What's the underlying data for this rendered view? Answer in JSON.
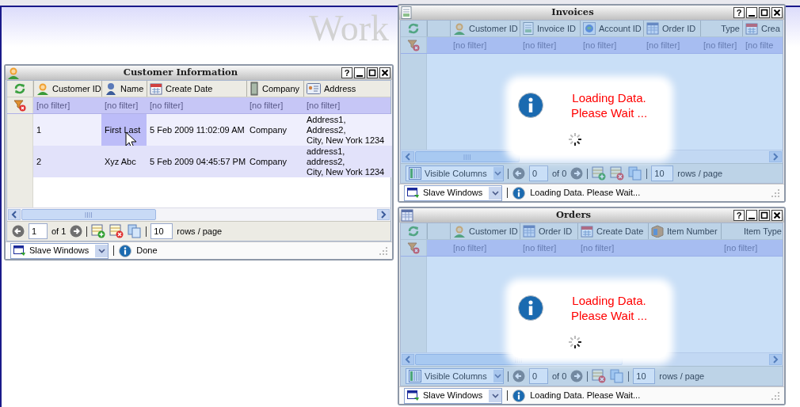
{
  "heading": "Work",
  "windows": [
    {
      "title": "Customer Information",
      "kind": "person",
      "help": "?",
      "loading": false,
      "columns": [
        {
          "label": "Customer ID",
          "kind": "person",
          "filter": "[no filter]"
        },
        {
          "label": "Name",
          "kind": "user",
          "filter": "[no filter]"
        },
        {
          "label": "Create Date",
          "kind": "calendar",
          "filter": "[no filter]"
        },
        {
          "label": "Company",
          "kind": "building",
          "filter": "[no filter]"
        },
        {
          "label": "Address",
          "kind": "card",
          "filter": "[no filter]"
        }
      ],
      "rows": [
        {
          "cells": [
            {
              "text": "1",
              "selected": false
            },
            {
              "text": "First Last",
              "selected": true
            },
            {
              "text": "5 Feb 2009 11:02:09 AM",
              "selected": false
            },
            {
              "text": "Company",
              "selected": false
            },
            {
              "text": "Address1,\nAddress2,\nCity, New York 1234",
              "selected": false
            }
          ]
        },
        {
          "cells": [
            {
              "text": "2",
              "selected": false
            },
            {
              "text": "Xyz Abc",
              "selected": false
            },
            {
              "text": "5 Feb 2009 04:45:57 PM",
              "selected": false
            },
            {
              "text": "Company",
              "selected": false
            },
            {
              "text": "address1,\naddress2,\nCity, New York 1234",
              "selected": false
            }
          ]
        }
      ],
      "pager": {
        "page": "1",
        "total": "of 1",
        "tools": [
          {
            "kind": "add"
          },
          {
            "kind": "delete"
          },
          {
            "kind": "copy"
          }
        ],
        "rows_per_page": "10",
        "rows_label": "rows / page"
      },
      "status": {
        "windows": "Slave Windows",
        "message": "Done"
      }
    },
    {
      "title": "Invoices",
      "kind": "document",
      "help": "?",
      "loading": true,
      "loading_lines": [
        "Loading Data.",
        "Please Wait ..."
      ],
      "columns": [
        {
          "kind": "blank"
        },
        {
          "label": "Customer ID",
          "kind": "person",
          "filter": "[no filter]"
        },
        {
          "label": "Invoice ID",
          "kind": "document",
          "filter": "[no filter]"
        },
        {
          "label": "Account ID",
          "kind": "globe",
          "filter": "[no filter]"
        },
        {
          "label": "Order ID",
          "kind": "table",
          "filter": "[no filter]"
        },
        {
          "label": "Type",
          "kind": "plain",
          "filter": "[no filter]"
        },
        {
          "label": "Crea",
          "kind": "calendar",
          "filter": "[no filte"
        }
      ],
      "pager": {
        "columns_menu": "Visible Columns",
        "page": "0",
        "total": "of 0",
        "tools": [
          {
            "kind": "add"
          },
          {
            "kind": "delete"
          },
          {
            "kind": "copy"
          }
        ],
        "rows_per_page": "10",
        "rows_label": "rows / page"
      },
      "status": {
        "windows": "Slave Windows",
        "message": "Loading Data. Please Wait..."
      }
    },
    {
      "title": "Orders",
      "kind": "table",
      "help": "?",
      "loading": true,
      "loading_lines": [
        "Loading Data.",
        "Please Wait ..."
      ],
      "columns": [
        {
          "kind": "blank"
        },
        {
          "label": "Customer ID",
          "kind": "person",
          "filter": "[no filter]"
        },
        {
          "label": "Order ID",
          "kind": "table",
          "filter": "[no filter]"
        },
        {
          "label": "Create Date",
          "kind": "calendar",
          "filter": "[no filter]"
        },
        {
          "label": "Item Number",
          "kind": "box"
        },
        {
          "label": "Item Type",
          "kind": "plain",
          "filter": "[no filter]"
        }
      ],
      "pager": {
        "columns_menu": "Visible Columns",
        "page": "0",
        "total": "of 0",
        "tools": [
          {
            "kind": "delete"
          },
          {
            "kind": "copy"
          }
        ],
        "rows_per_page": "10",
        "rows_label": "rows / page"
      },
      "status": {
        "windows": "Slave Windows",
        "message": "Loading Data. Please Wait..."
      }
    }
  ]
}
